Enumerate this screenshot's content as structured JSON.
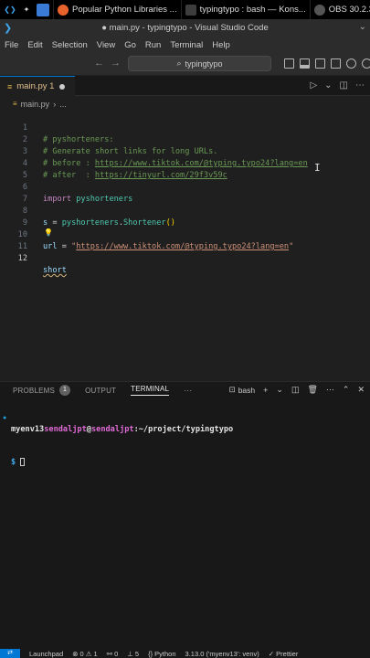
{
  "taskbar": {
    "tabs": [
      {
        "label": "Popular Python Libraries ...",
        "color": "#e8632b"
      },
      {
        "label": "typingtypo : bash — Kons...",
        "color": "#3d3d3d"
      },
      {
        "label": "OBS 30.2.3",
        "color": "#555555"
      }
    ]
  },
  "titlebar": {
    "title": "● main.py - typingtypo - Visual Studio Code"
  },
  "menu": {
    "items": [
      "File",
      "Edit",
      "Selection",
      "View",
      "Go",
      "Run",
      "Terminal",
      "Help"
    ]
  },
  "toolbar": {
    "search_text": "typingtypo"
  },
  "tab": {
    "label": "main.py 1"
  },
  "breadcrumb": {
    "file": "main.py",
    "more": "..."
  },
  "editor": {
    "line_numbers": [
      "1",
      "2",
      "3",
      "4",
      "5",
      "6",
      "7",
      "8",
      "9",
      "10",
      "11",
      "12"
    ],
    "line1_comment": "# pyshorteners:",
    "line2_comment": "# Generate short links for long URLs.",
    "line3_comment": "# before : ",
    "line3_link": "https://www.tiktok.com/@typing.typo24?lang=en",
    "line4_comment": "# after  : ",
    "line4_link": "https://tinyurl.com/29f3v59c",
    "line6_kw": "import",
    "line6_mod": "pyshorteners",
    "line8_var": "s",
    "line8_eq": " = ",
    "line8_mod": "pyshorteners",
    "line8_dot": ".",
    "line8_cls": "Shortener",
    "line8_parens": "()",
    "line10_var": "url",
    "line10_eq": " = ",
    "line10_q1": "\"",
    "line10_link": "https://www.tiktok.com/@typing.typo24?lang=en",
    "line10_q2": "\"",
    "line12_text": "short"
  },
  "panel": {
    "tabs": [
      "PROBLEMS",
      "OUTPUT",
      "TERMINAL"
    ],
    "problems_count": "1",
    "more": "···",
    "shell": "bash"
  },
  "terminal": {
    "user": "myenv13",
    "host1": "sendaljpt",
    "at": "@",
    "host2": "sendaljpt",
    "path": ":~/project/typingtypo",
    "prompt": "$ "
  },
  "statusbar": {
    "launchpad": "Launchpad",
    "errors": "⊗ 0 ⚠ 1",
    "ports": "⚯ 0",
    "lines": "⊥ 5",
    "language": "{} Python",
    "version": "3.13.0 ('myenv13': venv)",
    "prettier": "✓ Prettier"
  }
}
